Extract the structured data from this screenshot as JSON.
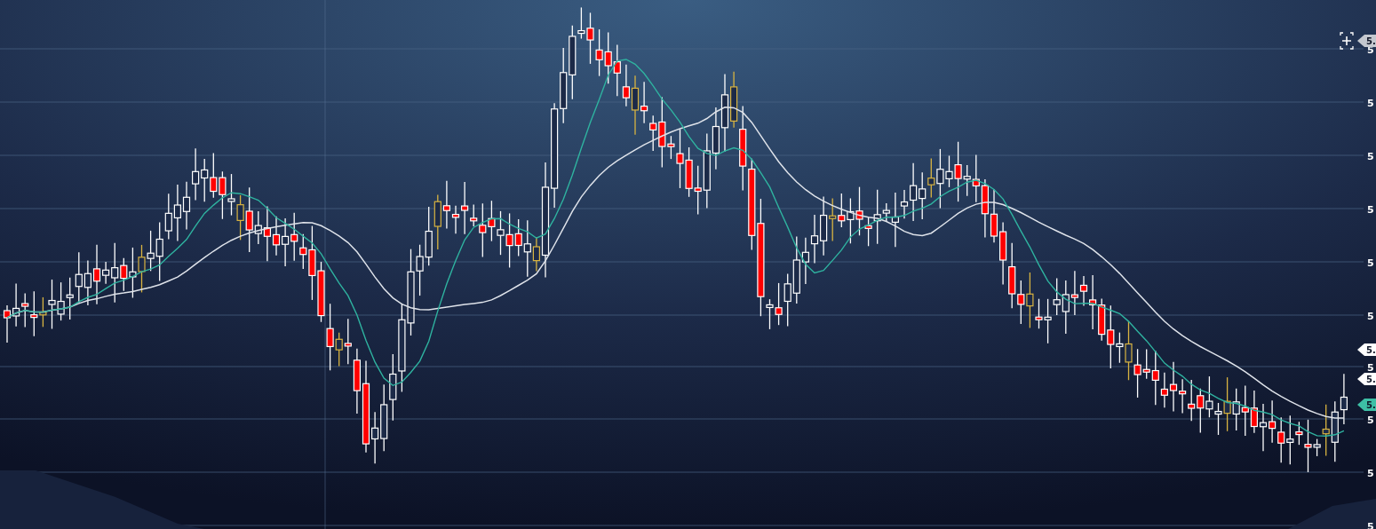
{
  "chart": {
    "axis_labels": [
      "5",
      "5",
      "5",
      "5",
      "5",
      "5",
      "5",
      "5",
      "5",
      "5"
    ]
  },
  "price_tags": [
    {
      "text": "5.",
      "color": "#c4c8cf"
    },
    {
      "text": "5.",
      "color": "#ffffff"
    },
    {
      "text": "5.",
      "color": "#ffffff"
    },
    {
      "text": "5.",
      "color": "#3dbfa5"
    }
  ]
}
